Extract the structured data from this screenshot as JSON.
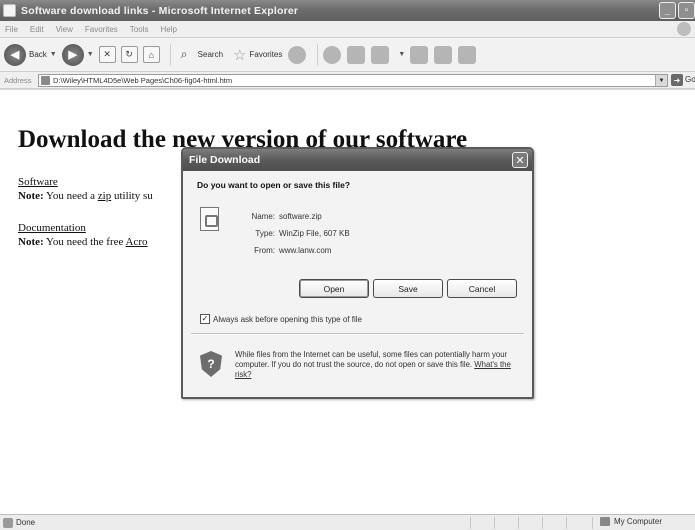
{
  "window": {
    "title": "Software download links - Microsoft Internet Explorer",
    "controls": [
      "_",
      "▫",
      "✕"
    ]
  },
  "menu": [
    "File",
    "Edit",
    "View",
    "Favorites",
    "Tools",
    "Help"
  ],
  "toolbar": {
    "back_label": "Back",
    "search_label": "Search",
    "favorites_label": "Favorites"
  },
  "address": {
    "label": "Address",
    "url": "D:\\Wiley\\HTML4D5e\\Web Pages\\Ch06-fig04-html.htm",
    "go_label": "Go"
  },
  "page": {
    "heading": "Download the new version of our software",
    "software_link": "Software",
    "note1_prefix": "Note:",
    "note1_text": " You need a ",
    "note1_link": "zip",
    "note1_rest": " utility su",
    "documentation_link": "Documentation",
    "note2_prefix": "Note:",
    "note2_text": " You need the free ",
    "note2_link": "Acro"
  },
  "dialog": {
    "title": "File Download",
    "question": "Do you want to open or save this file?",
    "name_label": "Name:",
    "name_value": "software.zip",
    "type_label": "Type:",
    "type_value": "WinZip File, 607 KB",
    "from_label": "From:",
    "from_value": "www.lanw.com",
    "open_label": "Open",
    "save_label": "Save",
    "cancel_label": "Cancel",
    "always_ask_label": "Always ask before opening this type of file",
    "always_ask_checked": true,
    "warning_text": "While files from the Internet can be useful, some files can potentially harm your computer. If you do not trust the source, do not open or save this file. ",
    "risk_link": "What's the risk?"
  },
  "status": {
    "text": "Done",
    "zone": "My Computer"
  }
}
